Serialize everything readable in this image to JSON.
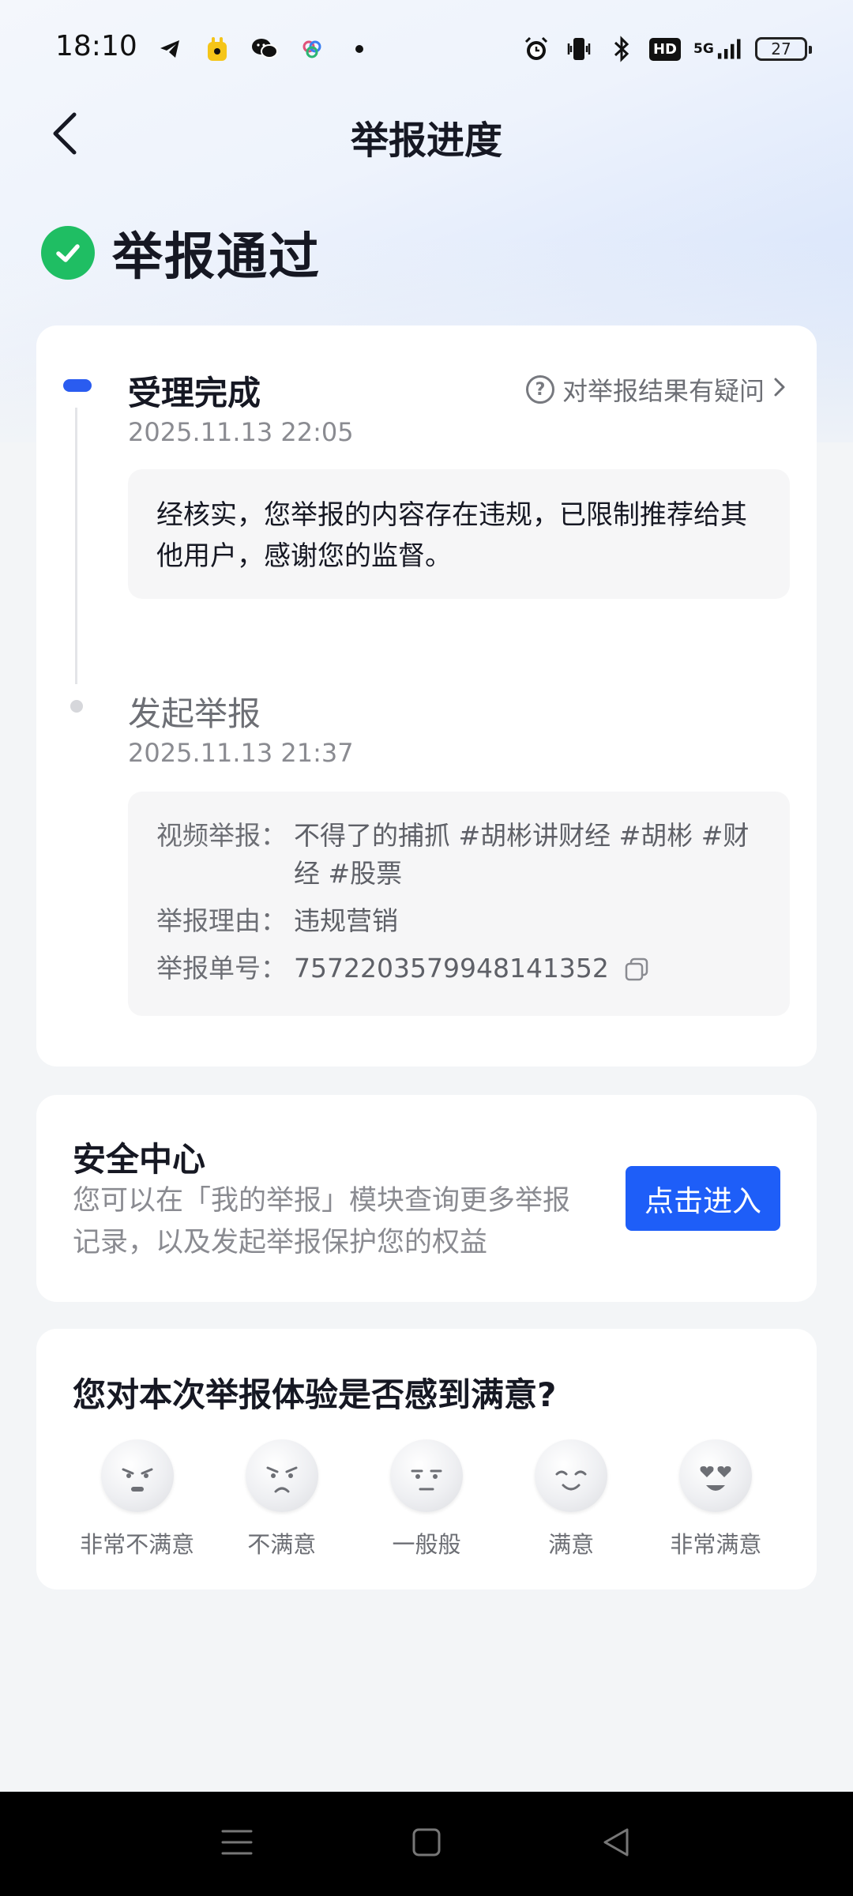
{
  "status_bar": {
    "time": "18:10",
    "left_icons": [
      "telegram-icon",
      "app-icon",
      "wechat-icon",
      "app-icon",
      "dot-icon"
    ],
    "right_icons": [
      "alarm-icon",
      "vibrate-icon",
      "bluetooth-icon",
      "hd-icon",
      "signal-icon",
      "battery-icon"
    ],
    "hd": "HD",
    "network": "5G",
    "battery": "27"
  },
  "header": {
    "title": "举报进度"
  },
  "result": {
    "text": "举报通过"
  },
  "timeline": {
    "question_link": "对举报结果有疑问",
    "steps": [
      {
        "title": "受理完成",
        "time": "2025.11.13 22:05",
        "content": "经核实，您举报的内容存在违规，已限制推荐给其他用户，感谢您的监督。"
      },
      {
        "title": "发起举报",
        "time": "2025.11.13 21:37",
        "details": [
          {
            "key": "视频举报：",
            "value": "不得了的捕抓 #胡彬讲财经 #胡彬 #财经 #股票"
          },
          {
            "key": "举报理由：",
            "value": "违规营销"
          },
          {
            "key": "举报单号：",
            "value": "7572203579948141352"
          }
        ]
      }
    ]
  },
  "safety": {
    "title": "安全中心",
    "description": "您可以在「我的举报」模块查询更多举报记录，以及发起举报保护您的权益",
    "button": "点击进入"
  },
  "survey": {
    "question": "您对本次举报体验是否感到满意?",
    "options": [
      {
        "label": "非常不满意",
        "icon": "very-unsatisfied-face-icon"
      },
      {
        "label": "不满意",
        "icon": "unsatisfied-face-icon"
      },
      {
        "label": "一般般",
        "icon": "neutral-face-icon"
      },
      {
        "label": "满意",
        "icon": "satisfied-face-icon"
      },
      {
        "label": "非常满意",
        "icon": "very-satisfied-face-icon"
      }
    ]
  },
  "colors": {
    "accent": "#1e5ef8",
    "success": "#1fbe63",
    "timeline_active": "#2a5cf0"
  }
}
